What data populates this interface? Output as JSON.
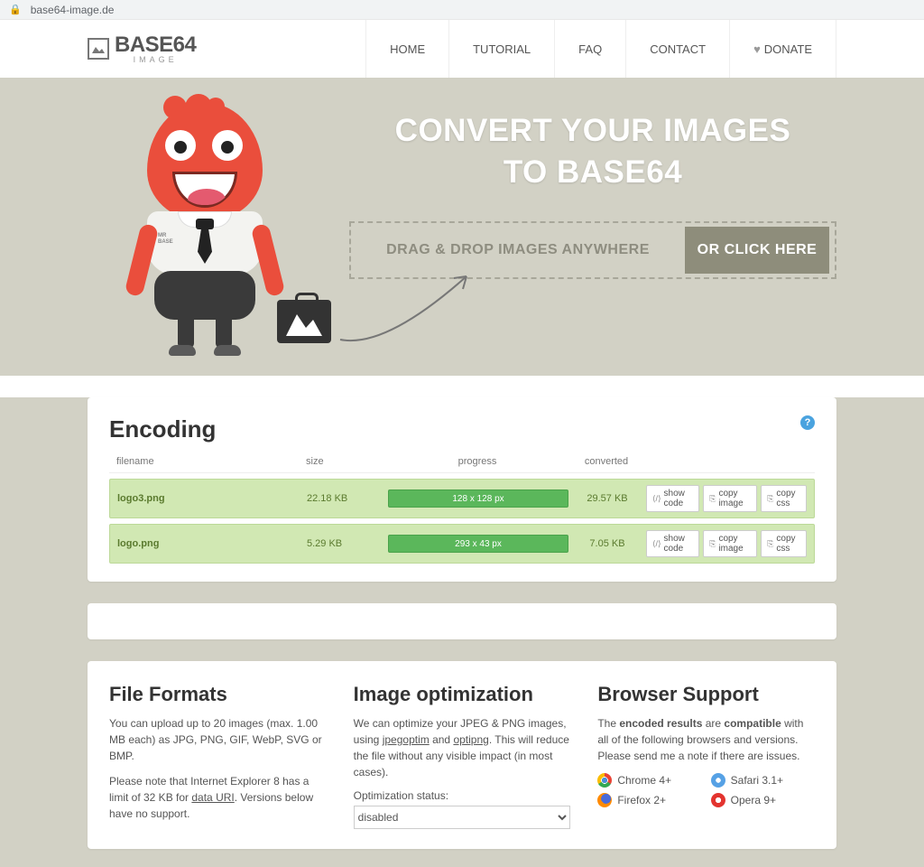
{
  "url_display": "base64-image.de",
  "logo": {
    "main": "BASE64",
    "sub": "IMAGE"
  },
  "nav": {
    "home": "HOME",
    "tutorial": "TUTORIAL",
    "faq": "FAQ",
    "contact": "CONTACT",
    "donate": "DONATE"
  },
  "hero": {
    "title_line1": "CONVERT YOUR IMAGES",
    "title_line2": "TO BASE64",
    "drop_text": "DRAG & DROP IMAGES ANYWHERE",
    "click_btn": "OR CLICK HERE",
    "mascot_tag_l1": "MR",
    "mascot_tag_l2": "BASE"
  },
  "encoding": {
    "title": "Encoding",
    "help_glyph": "?",
    "headers": {
      "filename": "filename",
      "size": "size",
      "progress": "progress",
      "converted": "converted"
    },
    "rows": [
      {
        "filename": "logo3.png",
        "size": "22.18 KB",
        "progress": "128 x 128 px",
        "converted": "29.57 KB"
      },
      {
        "filename": "logo.png",
        "size": "5.29 KB",
        "progress": "293 x 43 px",
        "converted": "7.05 KB"
      }
    ],
    "actions": {
      "show_code": "show code",
      "copy_image": "copy image",
      "copy_css": "copy css"
    }
  },
  "info_cols": {
    "formats": {
      "title": "File Formats",
      "p1": "You can upload up to 20 images (max. 1.00 MB each) as JPG, PNG, GIF, WebP, SVG or BMP.",
      "p2_pre": "Please note that Internet Explorer 8 has a limit of 32 KB for ",
      "p2_link": "data URI",
      "p2_post": ". Versions below have no support."
    },
    "optimization": {
      "title": "Image optimization",
      "p_pre": "We can optimize your JPEG & PNG images, using ",
      "link1": "jpegoptim",
      "mid": " and ",
      "link2": "optipng",
      "p_post": ". This will reduce the file without any visible impact (in most cases).",
      "status_label": "Optimization status:",
      "status_value": "disabled"
    },
    "browsers": {
      "title": "Browser Support",
      "p_pre": "The ",
      "b1": "encoded results",
      "p_mid": " are ",
      "b2": "compatible",
      "p_post": " with all of the following browsers and versions. Please send me a note if there are issues.",
      "list": {
        "chrome": "Chrome 4+",
        "safari": "Safari 3.1+",
        "firefox": "Firefox 2+",
        "opera": "Opera 9+"
      }
    }
  }
}
